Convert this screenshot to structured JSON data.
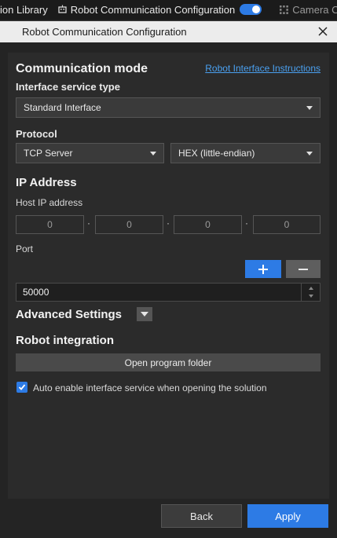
{
  "topbar": {
    "item1_label": "ion Library",
    "item2_label": "Robot Communication Configuration",
    "item3_label": "Camera Cali"
  },
  "dialog": {
    "title": "Robot Communication Configuration"
  },
  "communication": {
    "heading": "Communication mode",
    "instructions_link": "Robot Interface Instructions",
    "service_type_label": "Interface service type",
    "service_type_value": "Standard Interface",
    "protocol_label": "Protocol",
    "protocol_value": "TCP Server",
    "encoding_value": "HEX (little-endian)"
  },
  "ip": {
    "heading": "IP Address",
    "host_label": "Host IP address",
    "octets": [
      "0",
      "0",
      "0",
      "0"
    ],
    "port_label": "Port",
    "port_value": "50000"
  },
  "advanced": {
    "heading": "Advanced Settings"
  },
  "integration": {
    "heading": "Robot integration",
    "open_folder_label": "Open program folder",
    "auto_enable_label": "Auto enable interface service when opening the solution",
    "auto_enable_checked": true
  },
  "footer": {
    "back_label": "Back",
    "apply_label": "Apply"
  },
  "colors": {
    "accent": "#2d7be5",
    "link": "#4aa0f0"
  }
}
